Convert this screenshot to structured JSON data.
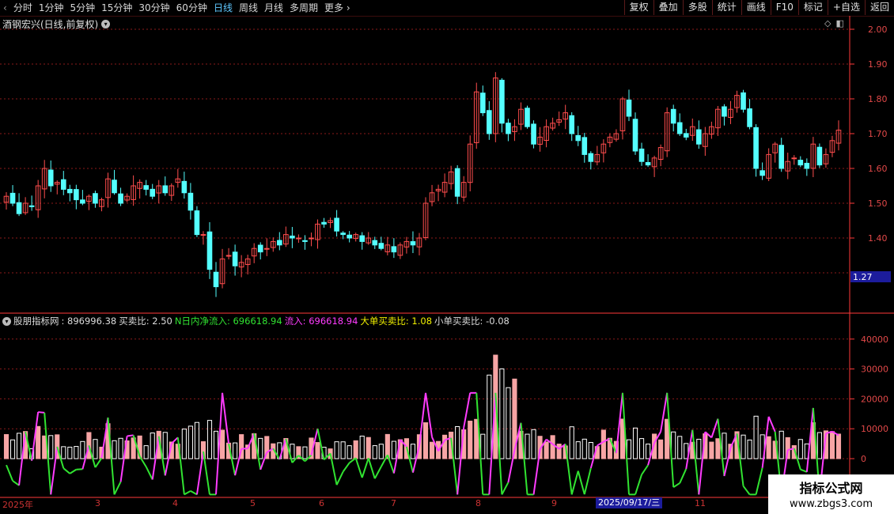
{
  "toolbar": {
    "tabs": [
      "分时",
      "1分钟",
      "5分钟",
      "15分钟",
      "30分钟",
      "60分钟",
      "日线",
      "周线",
      "月线",
      "多周期",
      "更多"
    ],
    "active_tab": "日线",
    "menu": [
      "复权",
      "叠加",
      "多股",
      "统计",
      "画线",
      "F10",
      "标记",
      "+自选",
      "返回"
    ]
  },
  "stock": {
    "title": "酒钢宏兴(日线,前复权)",
    "cursor_price": "1.27"
  },
  "price_axis": [
    "2.00",
    "1.90",
    "1.80",
    "1.70",
    "1.60",
    "1.50",
    "1.40"
  ],
  "vol_axis": [
    "40000",
    "30000",
    "20000",
    "10000",
    "0"
  ],
  "indicator": {
    "name": "股朋指标网",
    "items": [
      {
        "label": ": 896996.38",
        "color": "#dcdcdc"
      },
      {
        "label": "买卖比: 2.50",
        "color": "#dcdcdc"
      },
      {
        "label": "N日内净流入: 696618.94",
        "color": "#31e331"
      },
      {
        "label": "流入: 696618.94",
        "color": "#ff3cff"
      },
      {
        "label": "大单买卖比: 1.08",
        "color": "#f0f000"
      },
      {
        "label": "小单买卖比: -0.08",
        "color": "#dcdcdc"
      }
    ]
  },
  "date_bar": {
    "year_label": "2025年",
    "months": [
      "3",
      "4",
      "5",
      "6",
      "7",
      "8",
      "9",
      "11"
    ],
    "tooltip": "2025/09/17/三"
  },
  "watermark": {
    "line1": "指标公式网",
    "line2": "www.zbgs3.com"
  },
  "colors": {
    "up": "#ff4d4d",
    "down": "#54ffff",
    "grid": "#8b1a1a",
    "netflow": "#31e331",
    "inflow": "#ff3cff",
    "axis": "#ff3a3a",
    "cursor": "#1c1c9c"
  },
  "chart_data": {
    "type": "candlestick",
    "ylim": [
      1.2,
      2.04
    ],
    "close": [
      1.52,
      1.5,
      1.47,
      1.5,
      1.49,
      1.55,
      1.6,
      1.55,
      1.56,
      1.54,
      1.53,
      1.51,
      1.5,
      1.52,
      1.5,
      1.51,
      1.57,
      1.53,
      1.5,
      1.52,
      1.55,
      1.56,
      1.54,
      1.52,
      1.55,
      1.53,
      1.55,
      1.57,
      1.53,
      1.48,
      1.41,
      1.41,
      1.31,
      1.26,
      1.34,
      1.35,
      1.32,
      1.33,
      1.34,
      1.37,
      1.36,
      1.37,
      1.39,
      1.38,
      1.41,
      1.4,
      1.4,
      1.39,
      1.4,
      1.44,
      1.44,
      1.45,
      1.42,
      1.41,
      1.4,
      1.41,
      1.39,
      1.4,
      1.38,
      1.37,
      1.38,
      1.36,
      1.38,
      1.39,
      1.38,
      1.4,
      1.5,
      1.53,
      1.54,
      1.56,
      1.59,
      1.52,
      1.56,
      1.67,
      1.82,
      1.76,
      1.7,
      1.86,
      1.73,
      1.7,
      1.72,
      1.77,
      1.72,
      1.67,
      1.69,
      1.72,
      1.73,
      1.74,
      1.76,
      1.7,
      1.68,
      1.64,
      1.62,
      1.64,
      1.67,
      1.69,
      1.7,
      1.8,
      1.75,
      1.65,
      1.62,
      1.61,
      1.63,
      1.66,
      1.76,
      1.73,
      1.7,
      1.69,
      1.72,
      1.67,
      1.7,
      1.72,
      1.77,
      1.75,
      1.77,
      1.81,
      1.77,
      1.72,
      1.6,
      1.58,
      1.64,
      1.67,
      1.6,
      1.62,
      1.63,
      1.61,
      1.6,
      1.67,
      1.61,
      1.64,
      1.68,
      1.71
    ]
  }
}
